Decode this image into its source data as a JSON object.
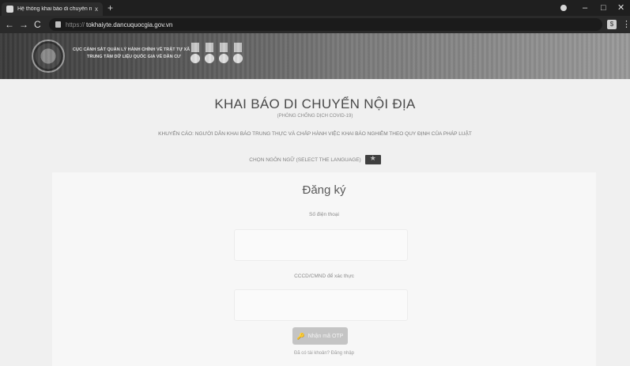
{
  "browser": {
    "tab_title": "Hệ thống khai báo di chuyển nộ...",
    "tab_close": "x",
    "new_tab": "+",
    "url_prefix": "https://",
    "url": "tokhaiyte.dancuquocgia.gov.vn",
    "ext_label": "$",
    "window_controls": [
      "–",
      "□",
      "✕"
    ],
    "kebab": "⋮",
    "nav": [
      "←",
      "→",
      "C"
    ]
  },
  "banner": {
    "line1": "CỤC CẢNH SÁT QUẢN LÝ HÀNH CHÍNH VỀ TRẬT TỰ XÃ HỘI",
    "line2": "TRUNG TÂM DỮ LIỆU QUỐC GIA VỀ DÂN CƯ"
  },
  "page": {
    "title": "KHAI BÁO DI CHUYỂN NỘI ĐỊA",
    "subtitle": "(PHÒNG CHỐNG DỊCH COVID-19)",
    "warning": "KHUYẾN CÁO: NGƯỜI DÂN KHAI BÁO TRUNG THỰC VÀ CHẤP HÀNH VIỆC KHAI BÁO NGHIÊM THEO QUY ĐỊNH CỦA PHÁP LUẬT",
    "lang_label": "CHỌN NGÔN NGỮ (SELECT THE LANGUAGE)"
  },
  "form": {
    "title": "Đăng ký",
    "phone_label": "Số điện thoại",
    "phone_value": "",
    "id_label": "CCCD/CMND để xác thực",
    "id_value": "",
    "otp_button": "Nhận mã OTP",
    "login_hint": "Đã có tài khoản? Đăng nhập"
  }
}
